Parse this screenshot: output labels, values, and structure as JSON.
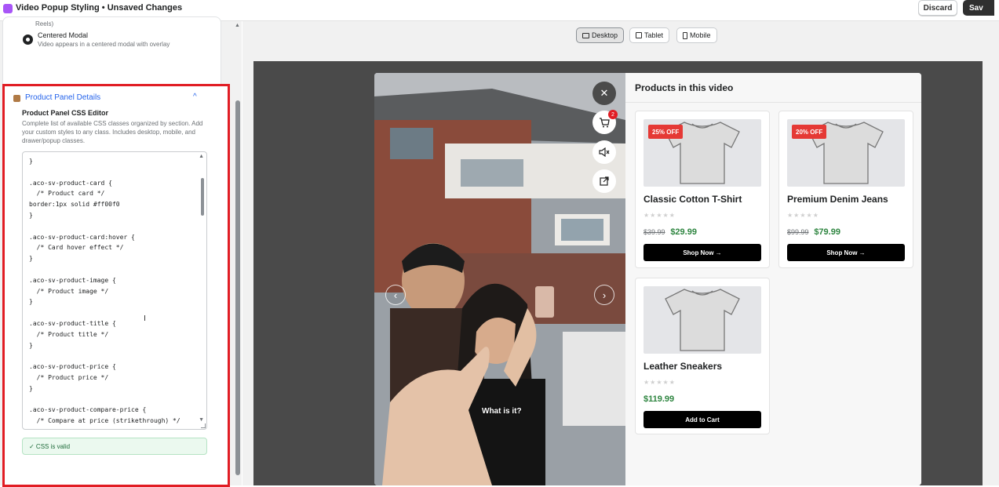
{
  "window": {
    "title": "Video Popup Styling • Unsaved Changes",
    "discard_label": "Discard",
    "save_label": "Sav"
  },
  "left_panel": {
    "reels_text": "Reels)",
    "option": {
      "title": "Centered Modal",
      "description": "Video appears in a centered modal with overlay"
    },
    "product_panel": {
      "heading": "Product Panel Details",
      "chevron": "^",
      "subheading": "Product Panel CSS Editor",
      "description": "Complete list of available CSS classes organized by section. Add your custom styles to any class. Includes desktop, mobile, and drawer/popup classes.",
      "css_code": "}\n\n.aco-sv-product-card {\n  /* Product card */\nborder:1px solid #ff00f0\n}\n\n.aco-sv-product-card:hover {\n  /* Card hover effect */\n}\n\n.aco-sv-product-image {\n  /* Product image */\n}\n\n.aco-sv-product-title {\n  /* Product title */\n}\n\n.aco-sv-product-price {\n  /* Product price */\n}\n\n.aco-sv-product-compare-price {\n  /* Compare at price (strikethrough) */",
      "valid_message": "✓ CSS is valid"
    }
  },
  "preview": {
    "devices": [
      {
        "label": "Desktop",
        "active": true
      },
      {
        "label": "Tablet",
        "active": false
      },
      {
        "label": "Mobile",
        "active": false
      }
    ],
    "video": {
      "cart_count": "2",
      "caption": "What is it?",
      "close_icon": "✕",
      "prev_icon": "‹",
      "next_icon": "›"
    },
    "products_heading": "Products in this video",
    "products": [
      {
        "name": "Classic Cotton T-Shirt",
        "badge": "25% OFF",
        "stars": "★★★★★",
        "compare_price": "$39.99",
        "price": "$29.99",
        "button": "Shop Now →"
      },
      {
        "name": "Premium Denim Jeans",
        "badge": "20% OFF",
        "stars": "★★★★★",
        "compare_price": "$99.99",
        "price": "$79.99",
        "button": "Shop Now →"
      },
      {
        "name": "Leather Sneakers",
        "badge": "",
        "stars": "★★★★★",
        "compare_price": "",
        "price": "$119.99",
        "button": "Add to Cart"
      }
    ]
  },
  "colors": {
    "highlight_border": "#e11d24",
    "accent_link": "#2463eb",
    "sale_badge": "#e53935",
    "price_green": "#2e8540"
  }
}
